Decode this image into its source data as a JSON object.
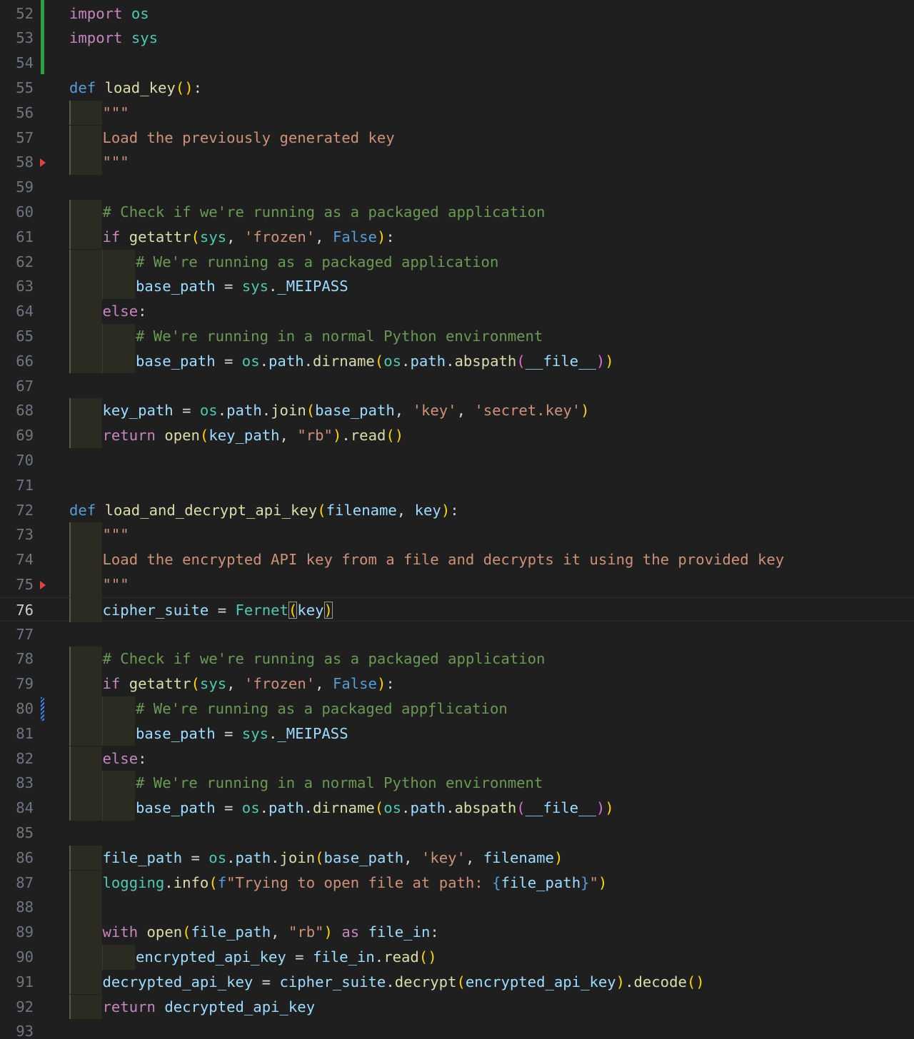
{
  "editor": {
    "active_line": 76,
    "lines": [
      {
        "n": "52",
        "indent": 0,
        "guides": 0,
        "tokens": [
          [
            "kw",
            "import"
          ],
          [
            "op",
            " "
          ],
          [
            "cls",
            "os"
          ]
        ]
      },
      {
        "n": "53",
        "indent": 0,
        "guides": 0,
        "tokens": [
          [
            "kw",
            "import"
          ],
          [
            "op",
            " "
          ],
          [
            "cls",
            "sys"
          ]
        ]
      },
      {
        "n": "54",
        "indent": 0,
        "guides": 0,
        "tokens": []
      },
      {
        "n": "55",
        "indent": 0,
        "guides": 0,
        "tokens": [
          [
            "def",
            "def"
          ],
          [
            "op",
            " "
          ],
          [
            "fn",
            "load_key"
          ],
          [
            "p1",
            "()"
          ],
          [
            "op",
            ":"
          ]
        ]
      },
      {
        "n": "56",
        "indent": 1,
        "guides": 1,
        "tokens": [
          [
            "str",
            "\"\"\""
          ]
        ]
      },
      {
        "n": "57",
        "indent": 1,
        "guides": 1,
        "tokens": [
          [
            "str",
            "Load the previously generated key"
          ]
        ]
      },
      {
        "n": "58",
        "indent": 1,
        "guides": 1,
        "tokens": [
          [
            "str",
            "\"\"\""
          ]
        ]
      },
      {
        "n": "59",
        "indent": 0,
        "guides": 0,
        "tokens": []
      },
      {
        "n": "60",
        "indent": 1,
        "guides": 1,
        "tokens": [
          [
            "cm",
            "# Check if we're running as a packaged application"
          ]
        ]
      },
      {
        "n": "61",
        "indent": 1,
        "guides": 1,
        "tokens": [
          [
            "kw",
            "if"
          ],
          [
            "op",
            " "
          ],
          [
            "fn",
            "getattr"
          ],
          [
            "p1",
            "("
          ],
          [
            "cls",
            "sys"
          ],
          [
            "op",
            ", "
          ],
          [
            "str",
            "'frozen'"
          ],
          [
            "op",
            ", "
          ],
          [
            "cst",
            "False"
          ],
          [
            "p1",
            ")"
          ],
          [
            "op",
            ":"
          ]
        ]
      },
      {
        "n": "62",
        "indent": 2,
        "guides": 2,
        "tokens": [
          [
            "cm",
            "# We're running as a packaged application"
          ]
        ]
      },
      {
        "n": "63",
        "indent": 2,
        "guides": 2,
        "tokens": [
          [
            "var",
            "base_path"
          ],
          [
            "op",
            " = "
          ],
          [
            "cls",
            "sys"
          ],
          [
            "op",
            "."
          ],
          [
            "var",
            "_MEIPASS"
          ]
        ]
      },
      {
        "n": "64",
        "indent": 1,
        "guides": 1,
        "tokens": [
          [
            "kw",
            "else"
          ],
          [
            "op",
            ":"
          ]
        ]
      },
      {
        "n": "65",
        "indent": 2,
        "guides": 2,
        "tokens": [
          [
            "cm",
            "# We're running in a normal Python environment"
          ]
        ]
      },
      {
        "n": "66",
        "indent": 2,
        "guides": 2,
        "tokens": [
          [
            "var",
            "base_path"
          ],
          [
            "op",
            " = "
          ],
          [
            "cls",
            "os"
          ],
          [
            "op",
            "."
          ],
          [
            "var",
            "path"
          ],
          [
            "op",
            "."
          ],
          [
            "fn",
            "dirname"
          ],
          [
            "p1",
            "("
          ],
          [
            "cls",
            "os"
          ],
          [
            "op",
            "."
          ],
          [
            "var",
            "path"
          ],
          [
            "op",
            "."
          ],
          [
            "fn",
            "abspath"
          ],
          [
            "p2",
            "("
          ],
          [
            "var",
            "__file__"
          ],
          [
            "p2",
            ")"
          ],
          [
            "p1",
            ")"
          ]
        ]
      },
      {
        "n": "67",
        "indent": 0,
        "guides": 0,
        "tokens": []
      },
      {
        "n": "68",
        "indent": 1,
        "guides": 1,
        "tokens": [
          [
            "var",
            "key_path"
          ],
          [
            "op",
            " = "
          ],
          [
            "cls",
            "os"
          ],
          [
            "op",
            "."
          ],
          [
            "var",
            "path"
          ],
          [
            "op",
            "."
          ],
          [
            "fn",
            "join"
          ],
          [
            "p1",
            "("
          ],
          [
            "var",
            "base_path"
          ],
          [
            "op",
            ", "
          ],
          [
            "str",
            "'key'"
          ],
          [
            "op",
            ", "
          ],
          [
            "str",
            "'secret.key'"
          ],
          [
            "p1",
            ")"
          ]
        ]
      },
      {
        "n": "69",
        "indent": 1,
        "guides": 1,
        "tokens": [
          [
            "kw",
            "return"
          ],
          [
            "op",
            " "
          ],
          [
            "fn",
            "open"
          ],
          [
            "p1",
            "("
          ],
          [
            "var",
            "key_path"
          ],
          [
            "op",
            ", "
          ],
          [
            "str",
            "\"rb\""
          ],
          [
            "p1",
            ")"
          ],
          [
            "op",
            "."
          ],
          [
            "fn",
            "read"
          ],
          [
            "p1",
            "()"
          ]
        ]
      },
      {
        "n": "70",
        "indent": 0,
        "guides": 0,
        "tokens": []
      },
      {
        "n": "71",
        "indent": 0,
        "guides": 0,
        "tokens": []
      },
      {
        "n": "72",
        "indent": 0,
        "guides": 0,
        "tokens": [
          [
            "def",
            "def"
          ],
          [
            "op",
            " "
          ],
          [
            "fn",
            "load_and_decrypt_api_key"
          ],
          [
            "p1",
            "("
          ],
          [
            "var",
            "filename"
          ],
          [
            "op",
            ", "
          ],
          [
            "var",
            "key"
          ],
          [
            "p1",
            ")"
          ],
          [
            "op",
            ":"
          ]
        ]
      },
      {
        "n": "73",
        "indent": 1,
        "guides": 1,
        "tokens": [
          [
            "str",
            "\"\"\""
          ]
        ]
      },
      {
        "n": "74",
        "indent": 1,
        "guides": 1,
        "tokens": [
          [
            "str",
            "Load the encrypted API key from a file and decrypts it using the provided key"
          ]
        ]
      },
      {
        "n": "75",
        "indent": 1,
        "guides": 1,
        "tokens": [
          [
            "str",
            "\"\"\""
          ]
        ]
      },
      {
        "n": "76",
        "indent": 1,
        "guides": 1,
        "tokens": [
          [
            "var",
            "cipher_suite"
          ],
          [
            "op",
            " = "
          ],
          [
            "cls",
            "Fernet"
          ],
          [
            "p1 bm",
            "("
          ],
          [
            "var",
            "key"
          ],
          [
            "p1 bm",
            ")"
          ]
        ]
      },
      {
        "n": "77",
        "indent": 0,
        "guides": 0,
        "tokens": []
      },
      {
        "n": "78",
        "indent": 1,
        "guides": 1,
        "tokens": [
          [
            "cm",
            "# Check if we're running as a packaged application"
          ]
        ]
      },
      {
        "n": "79",
        "indent": 1,
        "guides": 1,
        "tokens": [
          [
            "kw",
            "if"
          ],
          [
            "op",
            " "
          ],
          [
            "fn",
            "getattr"
          ],
          [
            "p1",
            "("
          ],
          [
            "cls",
            "sys"
          ],
          [
            "op",
            ", "
          ],
          [
            "str",
            "'frozen'"
          ],
          [
            "op",
            ", "
          ],
          [
            "cst",
            "False"
          ],
          [
            "p1",
            ")"
          ],
          [
            "op",
            ":"
          ]
        ]
      },
      {
        "n": "80",
        "indent": 2,
        "guides": 2,
        "tokens": [
          [
            "cm",
            "# We're running as a packaged appƒlication"
          ]
        ]
      },
      {
        "n": "81",
        "indent": 2,
        "guides": 2,
        "tokens": [
          [
            "var",
            "base_path"
          ],
          [
            "op",
            " = "
          ],
          [
            "cls",
            "sys"
          ],
          [
            "op",
            "."
          ],
          [
            "var",
            "_MEIPASS"
          ]
        ]
      },
      {
        "n": "82",
        "indent": 1,
        "guides": 1,
        "tokens": [
          [
            "kw",
            "else"
          ],
          [
            "op",
            ":"
          ]
        ]
      },
      {
        "n": "83",
        "indent": 2,
        "guides": 2,
        "tokens": [
          [
            "cm",
            "# We're running in a normal Python environment"
          ]
        ]
      },
      {
        "n": "84",
        "indent": 2,
        "guides": 2,
        "tokens": [
          [
            "var",
            "base_path"
          ],
          [
            "op",
            " = "
          ],
          [
            "cls",
            "os"
          ],
          [
            "op",
            "."
          ],
          [
            "var",
            "path"
          ],
          [
            "op",
            "."
          ],
          [
            "fn",
            "dirname"
          ],
          [
            "p1",
            "("
          ],
          [
            "cls",
            "os"
          ],
          [
            "op",
            "."
          ],
          [
            "var",
            "path"
          ],
          [
            "op",
            "."
          ],
          [
            "fn",
            "abspath"
          ],
          [
            "p2",
            "("
          ],
          [
            "var",
            "__file__"
          ],
          [
            "p2",
            ")"
          ],
          [
            "p1",
            ")"
          ]
        ]
      },
      {
        "n": "85",
        "indent": 0,
        "guides": 0,
        "tokens": []
      },
      {
        "n": "86",
        "indent": 1,
        "guides": 1,
        "tokens": [
          [
            "var",
            "file_path"
          ],
          [
            "op",
            " = "
          ],
          [
            "cls",
            "os"
          ],
          [
            "op",
            "."
          ],
          [
            "var",
            "path"
          ],
          [
            "op",
            "."
          ],
          [
            "fn",
            "join"
          ],
          [
            "p1",
            "("
          ],
          [
            "var",
            "base_path"
          ],
          [
            "op",
            ", "
          ],
          [
            "str",
            "'key'"
          ],
          [
            "op",
            ", "
          ],
          [
            "var",
            "filename"
          ],
          [
            "p1",
            ")"
          ]
        ]
      },
      {
        "n": "87",
        "indent": 1,
        "guides": 1,
        "tokens": [
          [
            "cls",
            "logging"
          ],
          [
            "op",
            "."
          ],
          [
            "fn",
            "info"
          ],
          [
            "p1",
            "("
          ],
          [
            "def",
            "f"
          ],
          [
            "str",
            "\"Trying to open file at path: "
          ],
          [
            "def",
            "{"
          ],
          [
            "var",
            "file_path"
          ],
          [
            "def",
            "}"
          ],
          [
            "str",
            "\""
          ],
          [
            "p1",
            ")"
          ]
        ]
      },
      {
        "n": "88",
        "indent": 0,
        "guides": 1,
        "tokens": []
      },
      {
        "n": "89",
        "indent": 1,
        "guides": 1,
        "tokens": [
          [
            "kw",
            "with"
          ],
          [
            "op",
            " "
          ],
          [
            "fn",
            "open"
          ],
          [
            "p1",
            "("
          ],
          [
            "var",
            "file_path"
          ],
          [
            "op",
            ", "
          ],
          [
            "str",
            "\"rb\""
          ],
          [
            "p1",
            ")"
          ],
          [
            "op",
            " "
          ],
          [
            "kw",
            "as"
          ],
          [
            "op",
            " "
          ],
          [
            "var",
            "file_in"
          ],
          [
            "op",
            ":"
          ]
        ]
      },
      {
        "n": "90",
        "indent": 2,
        "guides": 2,
        "tokens": [
          [
            "var",
            "encrypted_api_key"
          ],
          [
            "op",
            " = "
          ],
          [
            "var",
            "file_in"
          ],
          [
            "op",
            "."
          ],
          [
            "fn",
            "read"
          ],
          [
            "p1",
            "()"
          ]
        ]
      },
      {
        "n": "91",
        "indent": 1,
        "guides": 1,
        "tokens": [
          [
            "var",
            "decrypted_api_key"
          ],
          [
            "op",
            " = "
          ],
          [
            "var",
            "cipher_suite"
          ],
          [
            "op",
            "."
          ],
          [
            "fn",
            "decrypt"
          ],
          [
            "p1",
            "("
          ],
          [
            "var",
            "encrypted_api_key"
          ],
          [
            "p1",
            ")"
          ],
          [
            "op",
            "."
          ],
          [
            "fn",
            "decode"
          ],
          [
            "p1",
            "()"
          ]
        ]
      },
      {
        "n": "92",
        "indent": 1,
        "guides": 1,
        "tokens": [
          [
            "kw",
            "return"
          ],
          [
            "op",
            " "
          ],
          [
            "var",
            "decrypted_api_key"
          ]
        ]
      },
      {
        "n": "93",
        "indent": 0,
        "guides": 0,
        "tokens": []
      }
    ],
    "gutter_markers": [
      {
        "type": "git-added",
        "from_line": 52,
        "to_line": 54
      },
      {
        "type": "breakpoint-arrow",
        "line": 58
      },
      {
        "type": "breakpoint-arrow",
        "line": 75
      },
      {
        "type": "git-modified",
        "line": 80
      }
    ],
    "colors": {
      "background": "#1f1f1f",
      "line_number": "#6e7681",
      "active_line_number": "#cccccc",
      "git_added": "#2ea043",
      "git_modified": "#3b82f6",
      "breakpoint": "#e0443e"
    }
  }
}
